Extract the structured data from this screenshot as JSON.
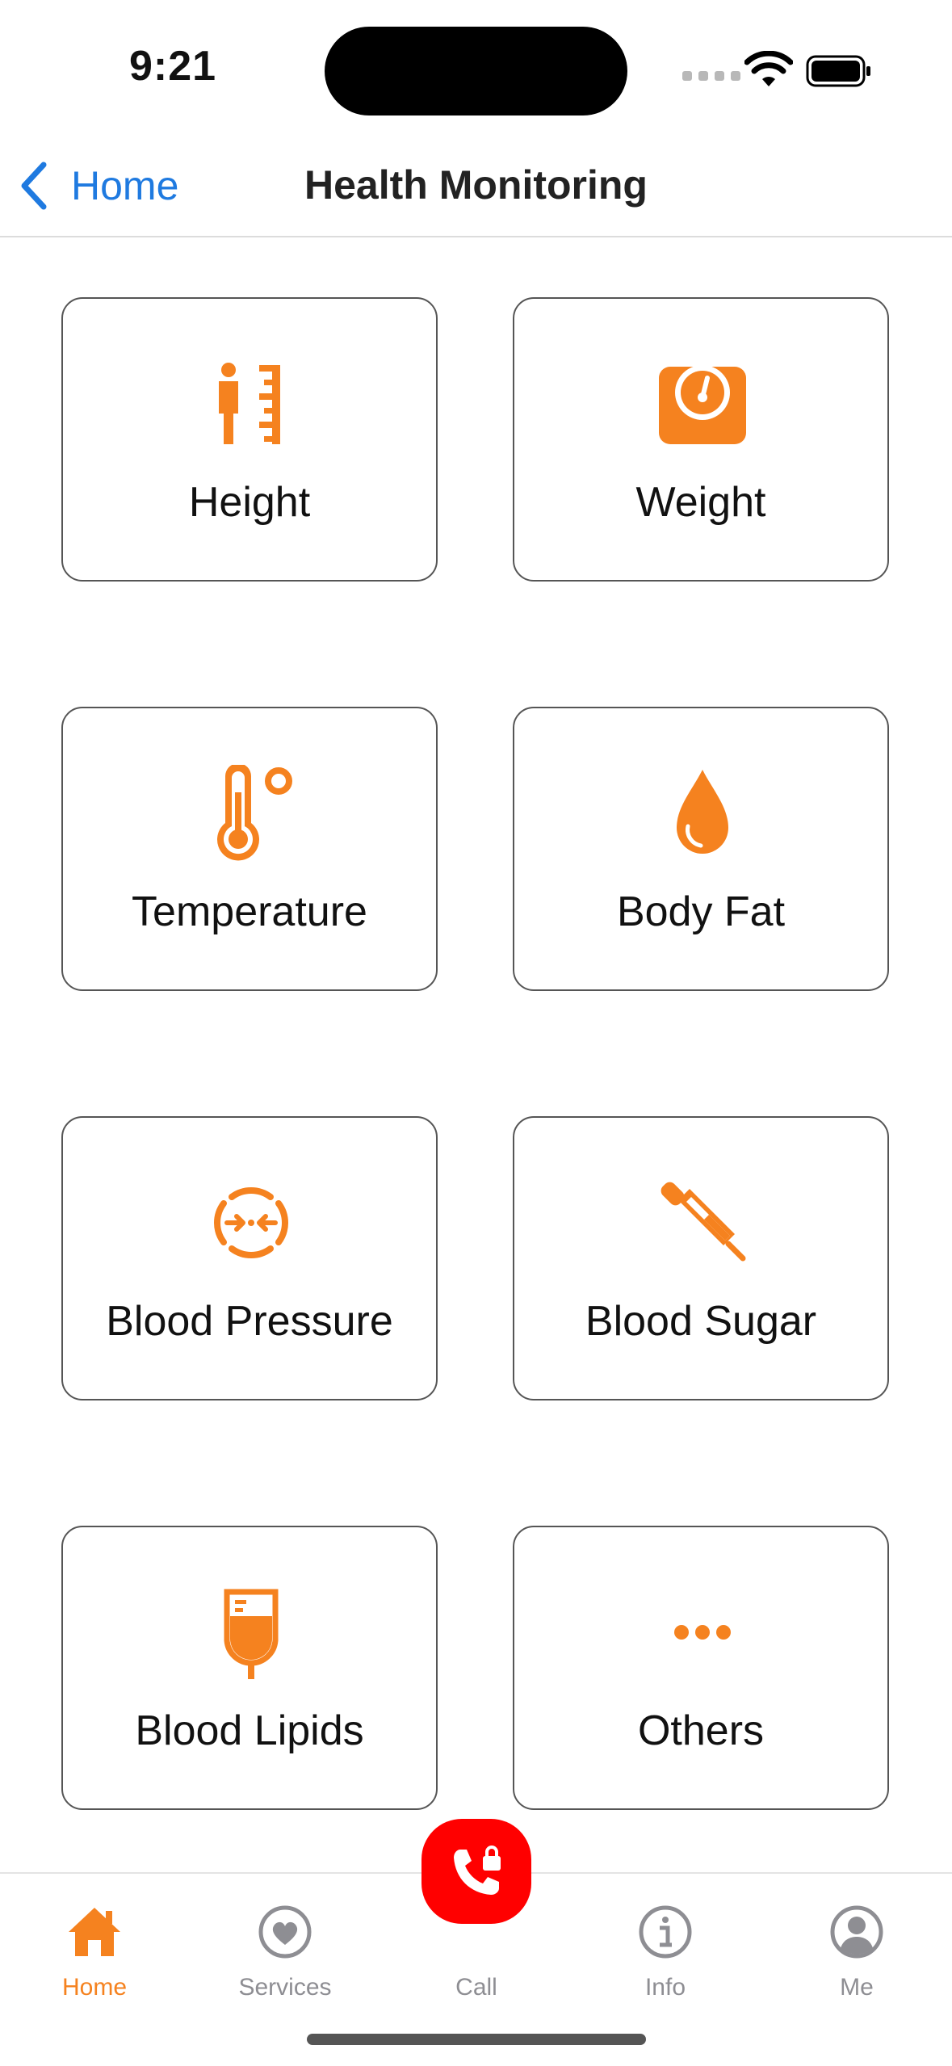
{
  "status": {
    "time": "9:21"
  },
  "nav": {
    "back_label": "Home",
    "title": "Health Monitoring"
  },
  "colors": {
    "accent": "#f5821f",
    "link": "#1f7ae0",
    "call": "#ff0000",
    "tab_inactive": "#8e8e93"
  },
  "tiles": [
    {
      "label": "Height",
      "icon": "height-measure-icon"
    },
    {
      "label": "Weight",
      "icon": "scale-icon"
    },
    {
      "label": "Temperature",
      "icon": "thermometer-icon"
    },
    {
      "label": "Body Fat",
      "icon": "drop-icon"
    },
    {
      "label": "Blood Pressure",
      "icon": "pressure-gauge-icon"
    },
    {
      "label": "Blood Sugar",
      "icon": "dropper-icon"
    },
    {
      "label": "Blood Lipids",
      "icon": "iv-bag-icon"
    },
    {
      "label": "Others",
      "icon": "more-dots-icon"
    }
  ],
  "tabs": [
    {
      "label": "Home",
      "icon": "house-icon",
      "active": true
    },
    {
      "label": "Services",
      "icon": "heart-circle-icon",
      "active": false
    },
    {
      "label": "Call",
      "icon": "phone-icon",
      "active": false
    },
    {
      "label": "Info",
      "icon": "info-icon",
      "active": false
    },
    {
      "label": "Me",
      "icon": "person-icon",
      "active": false
    }
  ]
}
